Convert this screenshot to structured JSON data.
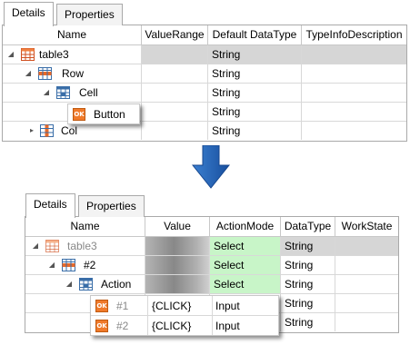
{
  "top": {
    "tabs": [
      {
        "label": "Details"
      },
      {
        "label": "Properties"
      }
    ],
    "columns": [
      "Name",
      "ValueRange",
      "Default DataType",
      "TypeInfoDescription"
    ],
    "rows": [
      {
        "name": "table3",
        "datatype": "String"
      },
      {
        "name": "Row",
        "datatype": "String"
      },
      {
        "name": "Cell",
        "datatype": "String"
      },
      {
        "name": "",
        "datatype": "String"
      },
      {
        "name": "Col",
        "datatype": "String"
      }
    ],
    "popup": {
      "label": "Button",
      "icon": "ok-icon"
    }
  },
  "bottom": {
    "tabs": [
      {
        "label": "Details"
      },
      {
        "label": "Properties"
      }
    ],
    "columns": [
      "Name",
      "Value",
      "ActionMode",
      "DataType",
      "WorkState"
    ],
    "rows": [
      {
        "name": "table3",
        "action": "Select",
        "datatype": "String"
      },
      {
        "name": "#2",
        "action": "Select",
        "datatype": "String"
      },
      {
        "name": "Action",
        "action": "Select",
        "datatype": "String"
      },
      {
        "datatype": "String"
      },
      {
        "datatype": "String"
      }
    ],
    "popup": [
      {
        "name": "#1",
        "value": "{CLICK}",
        "action": "Input"
      },
      {
        "name": "#2",
        "value": "{CLICK}",
        "action": "Input"
      }
    ]
  },
  "colors": {
    "accent_arrow": "#1b5fb4",
    "action_green": "#c8f5c8",
    "ok_icon": "#f07a2a"
  },
  "icons": {
    "table": "table-icon",
    "row": "row-icon",
    "cell": "cell-icon",
    "col": "col-icon",
    "ok": "ok-icon",
    "arrow": "down-arrow-icon"
  }
}
